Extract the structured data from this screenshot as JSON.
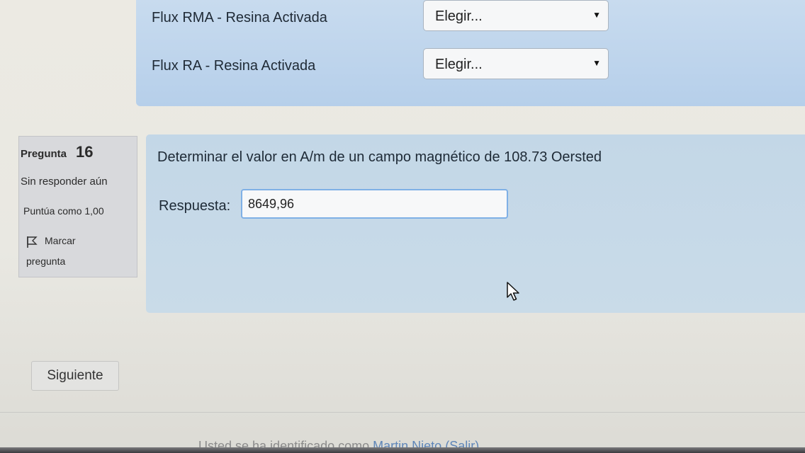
{
  "previous_question": {
    "rows": [
      {
        "label": "Flux RMA - Resina Activada",
        "selected": "Elegir..."
      },
      {
        "label": "Flux RA - Resina Activada",
        "selected": "Elegir..."
      }
    ]
  },
  "question_info": {
    "label": "Pregunta",
    "number": "16",
    "state": "Sin responder aún",
    "grade": "Puntúa como 1,00",
    "flag_line1": "Marcar",
    "flag_line2": "pregunta"
  },
  "question": {
    "text": "Determinar el valor en A/m de un campo magnético de 108.73 Oersted",
    "answer_label": "Respuesta:",
    "answer_value": "8649,96"
  },
  "navigation": {
    "next_label": "Siguiente"
  },
  "footer": {
    "login_prefix": "Usted se ha identificado como",
    "user_name": "Martin Nieto",
    "logout_label": "(Salir)"
  },
  "icons": {
    "select_arrow": "dropdown-arrow-icon",
    "flag": "flag-icon",
    "cursor": "mouse-pointer-icon"
  },
  "colors": {
    "panel_blue": "#c3d7e7",
    "info_gray": "#d8d9dc",
    "input_focus": "#7fb0e6"
  }
}
